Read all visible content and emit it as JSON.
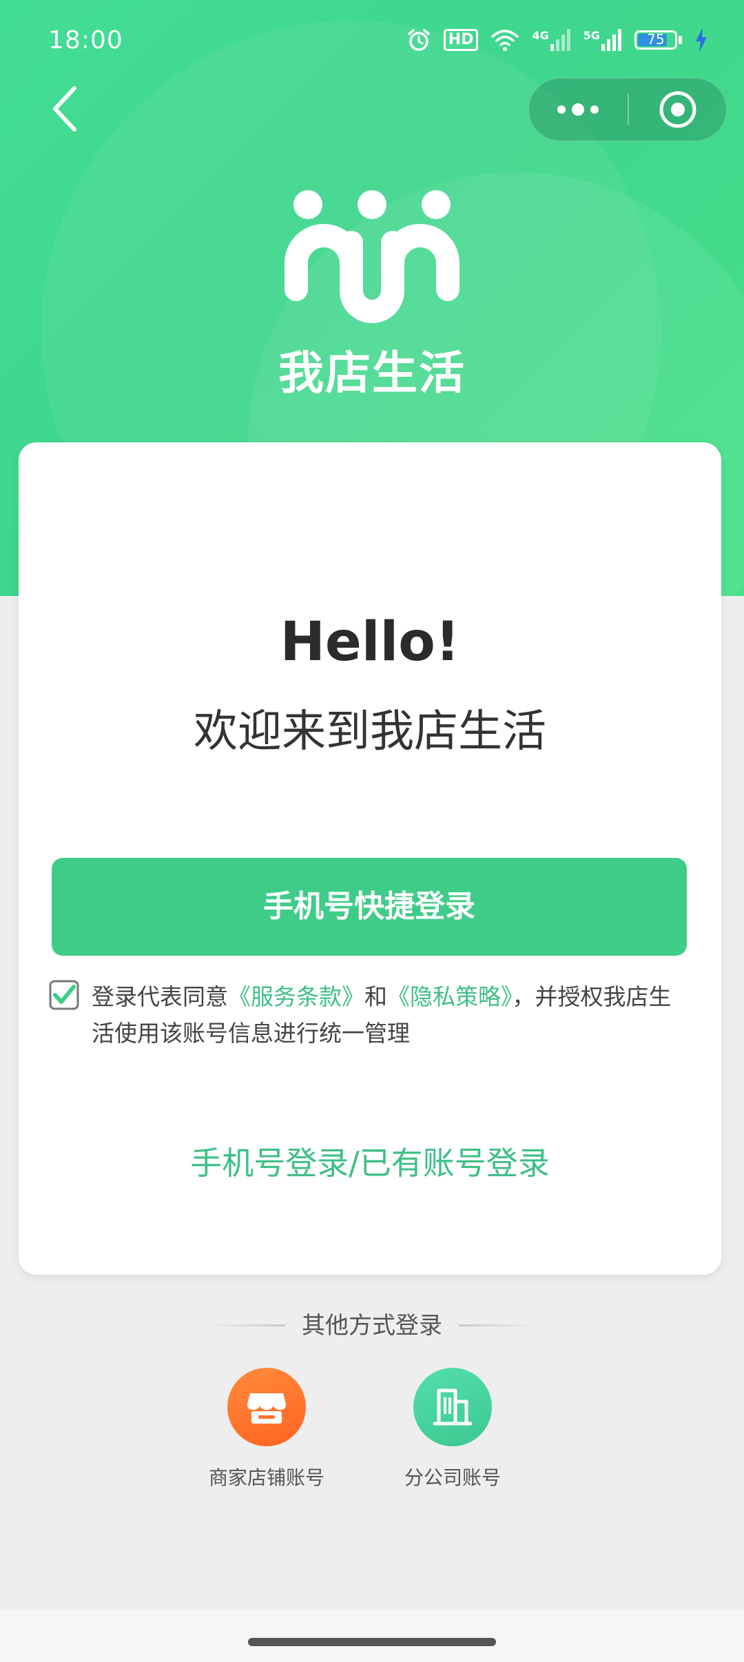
{
  "status_bar": {
    "time": "18:00",
    "hd_label": "HD",
    "network_1": "4G",
    "network_2": "5G",
    "battery_level": "75",
    "icons": [
      "alarm-icon",
      "hd-icon",
      "wifi-icon",
      "signal-icon",
      "signal-icon",
      "battery-icon",
      "charging-icon"
    ]
  },
  "header": {
    "brand_name": "我店生活",
    "back_icon": "chevron-left-icon",
    "more_icon": "more-dots-icon",
    "close_icon": "target-close-icon"
  },
  "card": {
    "hello": "Hello!",
    "welcome": "欢迎来到我店生活",
    "quick_login_label": "手机号快捷登录",
    "agreement": {
      "checked": true,
      "prefix": "登录代表同意",
      "terms_link": "《服务条款》",
      "and": "和",
      "privacy_link": "《隐私策略》",
      "suffix": "，并授权我店生活使用该账号信息进行统一管理"
    },
    "alt_login_label": "手机号登录/已有账号登录"
  },
  "other_login": {
    "title": "其他方式登录",
    "options": [
      {
        "label": "商家店铺账号",
        "icon": "storefront-icon",
        "color": "#ff7030"
      },
      {
        "label": "分公司账号",
        "icon": "building-icon",
        "color": "#45d39b"
      }
    ]
  },
  "colors": {
    "brand_green": "#3fd68d",
    "button_green": "#3fcc88",
    "link_green": "#3fbf86"
  }
}
